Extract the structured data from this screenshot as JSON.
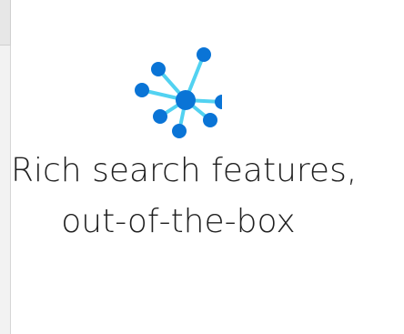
{
  "feature": {
    "title_line_1": "Rich search features,",
    "title_line_2": "out-of-the-box"
  },
  "colors": {
    "node": "#0a74d6",
    "line": "#52d2f1",
    "text": "#1f1f1f"
  },
  "icons": {
    "feature_icon": "network-graph-icon"
  }
}
